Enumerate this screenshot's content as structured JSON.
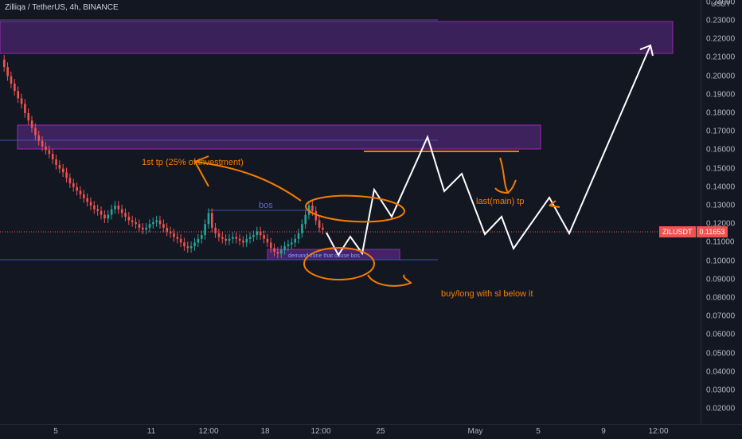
{
  "title": "Zilliqa / TetherUS, 4h, BINANCE",
  "currency": "USDT",
  "current_price": {
    "symbol": "ZILUSDT",
    "value": "0.11653"
  },
  "price_axis": {
    "labels": [
      "0.24000",
      "0.23000",
      "0.22000",
      "0.21000",
      "0.20000",
      "0.19000",
      "0.18000",
      "0.17000",
      "0.16000",
      "0.15000",
      "0.14000",
      "0.13000",
      "0.12000",
      "0.11000",
      "0.10000",
      "0.09000",
      "0.08000",
      "0.07000",
      "0.06000",
      "0.05000",
      "0.04000",
      "0.03000",
      "0.02000"
    ]
  },
  "time_axis": {
    "labels": [
      "5",
      "11",
      "12:00",
      "18",
      "12:00",
      "25",
      "May",
      "5",
      "9",
      "12:00"
    ]
  },
  "annotations": {
    "bos": "bos",
    "first_tp": "1st tp (25% of investment)",
    "demand_zone": "demand zone that cause bos",
    "buy_long": "buy/long with sl below it",
    "last_tp": "last(main) tp"
  },
  "colors": {
    "background": "#131722",
    "up_candle": "#26a69a",
    "down_candle": "#ef5350",
    "zone_fill": "#5b2a86",
    "zone_border": "#9c27b0",
    "hline": "#3f51b5",
    "orange": "#f57c00",
    "projection": "#ffffff"
  },
  "chart_data": {
    "type": "candlestick",
    "symbol": "ZILUSDT",
    "interval": "4h",
    "ylim": [
      0.02,
      0.24
    ],
    "closes": [
      0.205,
      0.2,
      0.196,
      0.192,
      0.188,
      0.185,
      0.18,
      0.176,
      0.172,
      0.168,
      0.165,
      0.162,
      0.16,
      0.158,
      0.155,
      0.152,
      0.15,
      0.148,
      0.145,
      0.142,
      0.14,
      0.138,
      0.136,
      0.134,
      0.132,
      0.13,
      0.128,
      0.127,
      0.125,
      0.123,
      0.125,
      0.128,
      0.13,
      0.128,
      0.126,
      0.124,
      0.122,
      0.121,
      0.12,
      0.118,
      0.117,
      0.118,
      0.12,
      0.121,
      0.122,
      0.12,
      0.118,
      0.116,
      0.115,
      0.113,
      0.112,
      0.11,
      0.108,
      0.107,
      0.108,
      0.11,
      0.112,
      0.114,
      0.12,
      0.126,
      0.118,
      0.115,
      0.113,
      0.112,
      0.111,
      0.112,
      0.113,
      0.112,
      0.111,
      0.11,
      0.112,
      0.113,
      0.114,
      0.116,
      0.114,
      0.112,
      0.11,
      0.107,
      0.105,
      0.104,
      0.106,
      0.108,
      0.109,
      0.11,
      0.112,
      0.115,
      0.12,
      0.125,
      0.13,
      0.127,
      0.122,
      0.118,
      0.117
    ]
  }
}
